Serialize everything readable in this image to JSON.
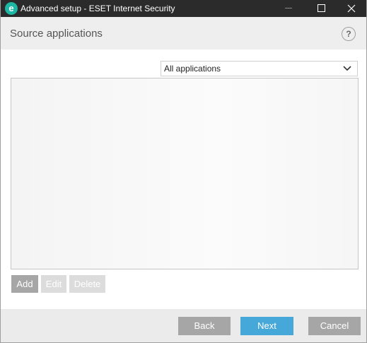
{
  "window": {
    "title": "Advanced setup - ESET Internet Security",
    "app_icon_letter": "e",
    "app_icon_name": "eset-logo-icon"
  },
  "header": {
    "title": "Source applications",
    "help_label": "?"
  },
  "filter": {
    "selected": "All applications"
  },
  "list": {
    "items": []
  },
  "actions": {
    "add": "Add",
    "edit": "Edit",
    "delete": "Delete"
  },
  "footer": {
    "back": "Back",
    "next": "Next",
    "cancel": "Cancel"
  },
  "colors": {
    "titlebar": "#2b2b2b",
    "accent": "#45a8d8",
    "logo": "#1cb8a5",
    "button_gray": "#a6a6a6",
    "button_disabled": "#dcdcdc"
  }
}
